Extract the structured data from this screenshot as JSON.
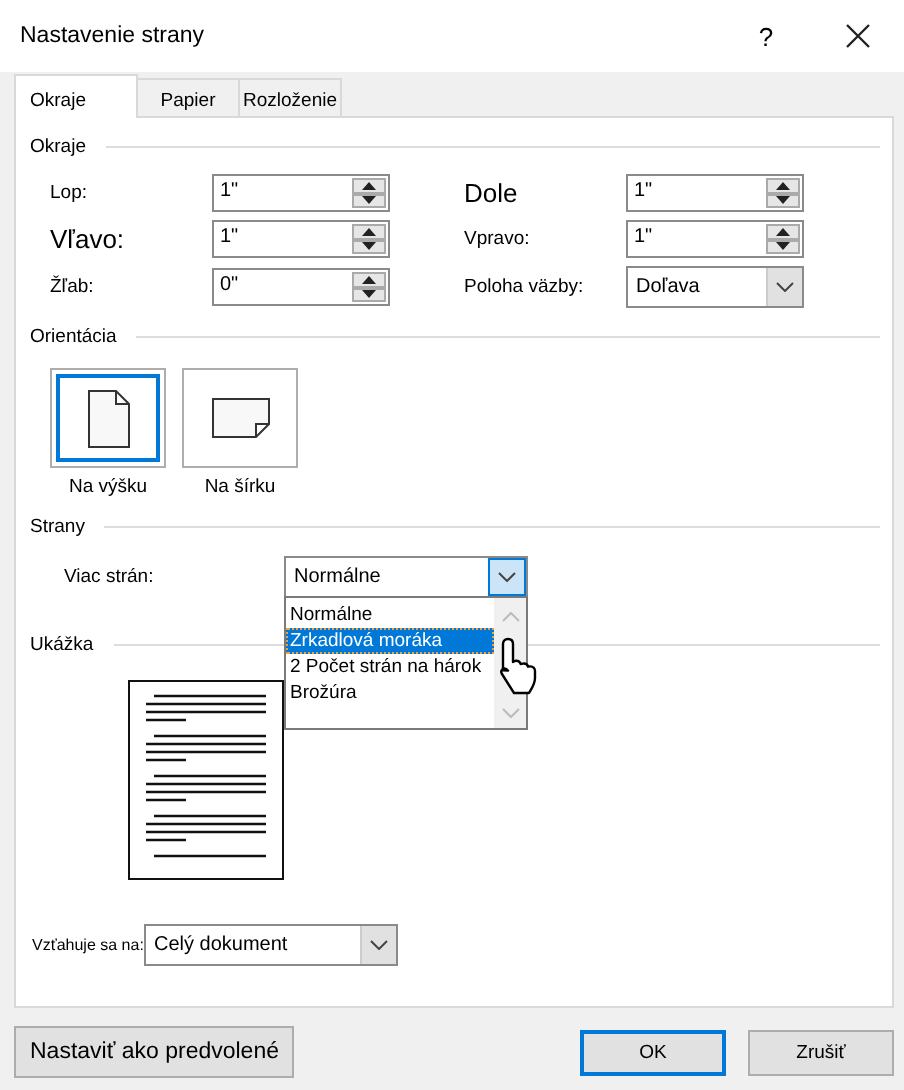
{
  "window": {
    "title": "Nastavenie strany",
    "help": "?"
  },
  "tabs": [
    {
      "label": "Okraje",
      "selected": true
    },
    {
      "label": "Papier",
      "selected": false
    },
    {
      "label": "Rozloženie",
      "selected": false
    }
  ],
  "margins": {
    "heading": "Okraje",
    "fields": [
      {
        "label": "Lop:",
        "value": "1\"",
        "kind": "spin",
        "large": false
      },
      {
        "label": "Dole",
        "value": "1\"",
        "kind": "spin",
        "large": true
      },
      {
        "label": "Vľavo:",
        "value": "1\"",
        "kind": "spin",
        "large": true
      },
      {
        "label": "Vpravo:",
        "value": "1\"",
        "kind": "spin",
        "large": false
      },
      {
        "label": "Žľab:",
        "value": "0\"",
        "kind": "spin",
        "large": false
      },
      {
        "label": "Poloha väzby:",
        "value": "Doľava",
        "kind": "select",
        "large": false
      }
    ]
  },
  "orientation": {
    "heading": "Orientácia",
    "options": [
      {
        "label": "Na výšku",
        "kind": "portrait",
        "selected": true
      },
      {
        "label": "Na šírku",
        "kind": "landscape",
        "selected": false
      }
    ]
  },
  "pages": {
    "heading": "Strany",
    "label": "Viac strán:",
    "value": "Normálne",
    "expanded": true,
    "options": [
      {
        "label": "Normálne",
        "highlighted": false
      },
      {
        "label": "Zrkadlová moráka",
        "highlighted": true
      },
      {
        "label": "2 Počet strán na hárok",
        "highlighted": false
      },
      {
        "label": "Brožúra",
        "highlighted": false
      }
    ]
  },
  "preview": {
    "heading": "Ukážka"
  },
  "apply": {
    "label": "Vzťahuje sa na:",
    "value": "Celý dokument"
  },
  "buttons": [
    {
      "label": "Nastaviť ako predvolené",
      "kind": "normal"
    },
    {
      "label": "OK",
      "kind": "primary"
    },
    {
      "label": "Zrušiť",
      "kind": "normal"
    }
  ]
}
